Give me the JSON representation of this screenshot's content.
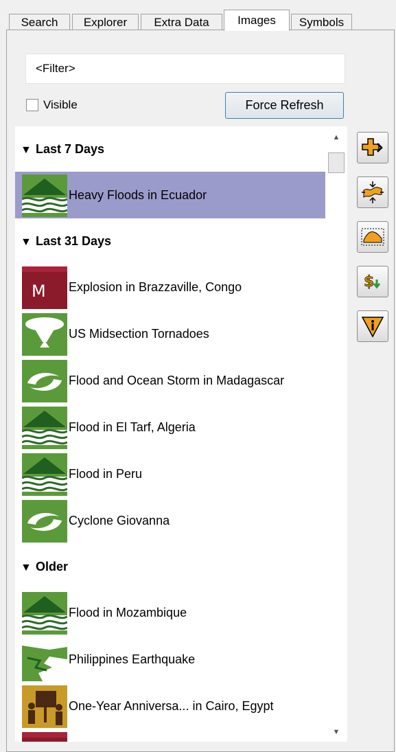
{
  "tabs": [
    "Search",
    "Explorer",
    "Extra Data",
    "Images",
    "Symbols"
  ],
  "active_tab": "Images",
  "filter": {
    "placeholder": "<Filter>"
  },
  "visible_checkbox": {
    "label": "Visible",
    "checked": false
  },
  "force_refresh_label": "Force Refresh",
  "groups": [
    {
      "title": "Last 7 Days",
      "items": [
        {
          "label": "Heavy Floods in Ecuador",
          "icon": "flood-icon",
          "selected": true
        }
      ]
    },
    {
      "title": "Last 31 Days",
      "items": [
        {
          "label": "Explosion in Brazzaville, Congo",
          "icon": "explosion-icon",
          "icon_text": "M"
        },
        {
          "label": "US Midsection Tornadoes",
          "icon": "tornado-icon"
        },
        {
          "label": "Flood and Ocean Storm in Madagascar",
          "icon": "cyclone-icon"
        },
        {
          "label": "Flood in El Tarf, Algeria",
          "icon": "flood-icon"
        },
        {
          "label": "Flood in Peru",
          "icon": "flood-icon"
        },
        {
          "label": "Cyclone Giovanna",
          "icon": "cyclone-icon"
        }
      ]
    },
    {
      "title": "Older",
      "items": [
        {
          "label": "Flood in Mozambique",
          "icon": "flood-icon"
        },
        {
          "label": "Philippines Earthquake",
          "icon": "earthquake-icon"
        },
        {
          "label": "One-Year Anniversa... in Cairo, Egypt",
          "icon": "protest-icon"
        },
        {
          "label": "",
          "icon": "explosion-icon"
        }
      ]
    }
  ],
  "side_buttons": [
    "add-layer-icon",
    "fit-extent-icon",
    "select-area-icon",
    "currency-download-icon",
    "info-warning-icon"
  ],
  "colors": {
    "selected_row": "#9b9bcb",
    "flood_green": "#4a8a2c",
    "explosion_red": "#8b1a2b",
    "button_orange": "#f0a020"
  }
}
